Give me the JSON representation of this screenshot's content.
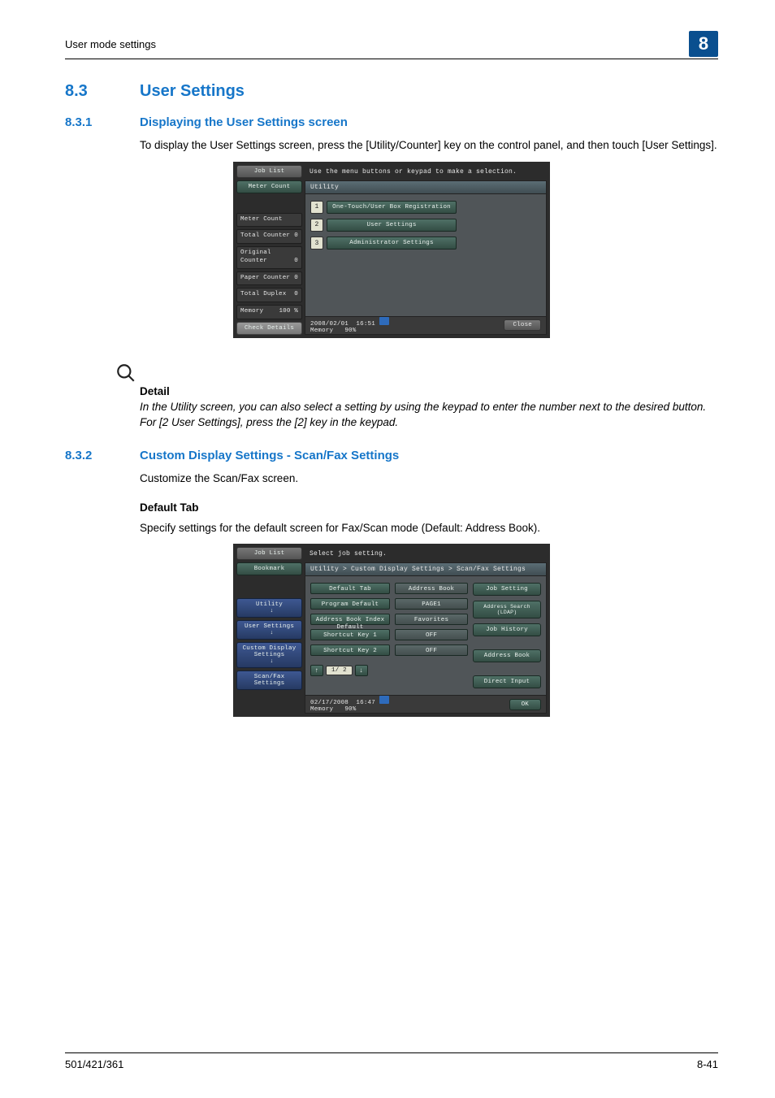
{
  "header": {
    "breadcrumb": "User mode settings",
    "chapter": "8"
  },
  "sections": {
    "h1": {
      "num": "8.3",
      "title": "User Settings"
    },
    "s831": {
      "num": "8.3.1",
      "title": "Displaying the User Settings screen",
      "para": "To display the User Settings screen, press the [Utility/Counter] key on the control panel, and then touch [User Settings]."
    },
    "note": {
      "title": "Detail",
      "body": "In the Utility screen, you can also select a setting by using the keypad to enter the number next to the desired button. For [2 User Settings], press the [2] key in the keypad."
    },
    "s832": {
      "num": "8.3.2",
      "title": "Custom Display Settings - Scan/Fax Settings",
      "para": "Customize the Scan/Fax screen.",
      "sub_title": "Default Tab",
      "sub_para": "Specify settings for the default screen for Fax/Scan mode (Default: Address Book)."
    }
  },
  "screenshot1": {
    "instruction": "Use the menu buttons or keypad to make a selection.",
    "job_list": "Job List",
    "meter_count_btn": "Meter Count",
    "panel_title": "Utility",
    "stats": {
      "meter": {
        "label": "Meter Count",
        "value": ""
      },
      "total": {
        "label": "Total Counter",
        "value": "0"
      },
      "original": {
        "label": "Original Counter",
        "value": "0"
      },
      "paper": {
        "label": "Paper Counter",
        "value": "0"
      },
      "duplex": {
        "label": "Total Duplex",
        "value": "0"
      },
      "memory": {
        "label": "Memory",
        "value": "100 %"
      }
    },
    "check_details": "Check Details",
    "menu": [
      {
        "n": "1",
        "label": "One-Touch/User Box Registration"
      },
      {
        "n": "2",
        "label": "User Settings"
      },
      {
        "n": "3",
        "label": "Administrator Settings"
      }
    ],
    "status": {
      "date": "2008/02/01",
      "time": "16:51",
      "mem_label": "Memory",
      "mem_val": "90%"
    },
    "close": "Close"
  },
  "screenshot2": {
    "instruction": "Select job setting.",
    "job_list": "Job List",
    "bookmark": "Bookmark",
    "breadcrumb": "Utility > Custom Display Settings > Scan/Fax Settings",
    "crumbs": {
      "utility": "Utility",
      "user_settings": "User Settings",
      "custom_display": "Custom Display Settings",
      "scanfax": "Scan/Fax Settings"
    },
    "settings": [
      {
        "name": "Default Tab",
        "value": "Address Book"
      },
      {
        "name": "Program Default",
        "value": "PAGE1"
      },
      {
        "name": "Address Book Index Default",
        "value": "Favorites"
      },
      {
        "name": "Shortcut Key 1",
        "value": "OFF"
      },
      {
        "name": "Shortcut Key 2",
        "value": "OFF"
      }
    ],
    "right_col": {
      "job_setting": "Job Setting",
      "addr_search": "Address Search (LDAP)",
      "job_history": "Job History",
      "addr_book": "Address Book",
      "direct_input": "Direct Input"
    },
    "pager": {
      "up": "↑",
      "label": "1/ 2",
      "down": "↓"
    },
    "status": {
      "date": "02/17/2008",
      "time": "16:47",
      "mem_label": "Memory",
      "mem_val": "90%"
    },
    "ok": "OK"
  },
  "footer": {
    "left": "501/421/361",
    "right": "8-41"
  }
}
